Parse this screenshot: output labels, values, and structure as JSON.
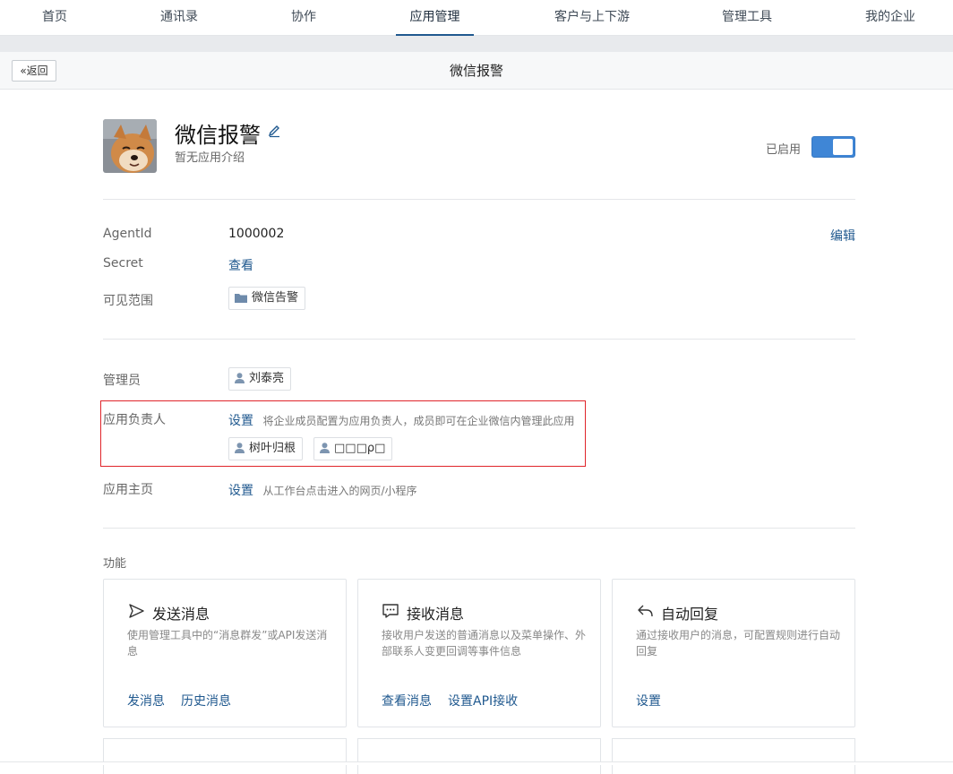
{
  "nav": {
    "items": [
      {
        "label": "首页"
      },
      {
        "label": "通讯录"
      },
      {
        "label": "协作"
      },
      {
        "label": "应用管理"
      },
      {
        "label": "客户与上下游"
      },
      {
        "label": "管理工具"
      },
      {
        "label": "我的企业"
      }
    ],
    "active_index": 3
  },
  "subheader": {
    "back_label": "返回",
    "title": "微信报警"
  },
  "app": {
    "name": "微信报警",
    "description": "暂无应用介绍",
    "status_label": "已启用",
    "enabled": true
  },
  "info": {
    "agentid_label": "AgentId",
    "agentid_value": "1000002",
    "edit_label": "编辑",
    "secret_label": "Secret",
    "secret_link": "查看",
    "scope_label": "可见范围",
    "scope_tag": "微信告警"
  },
  "admin": {
    "label": "管理员",
    "tag": "刘泰亮"
  },
  "owner": {
    "label": "应用负责人",
    "set_link": "设置",
    "hint": "将企业成员配置为应用负责人，成员即可在企业微信内管理此应用",
    "tags": [
      "树叶归根",
      "□□□ρ□"
    ]
  },
  "homepage": {
    "label": "应用主页",
    "set_link": "设置",
    "hint": "从工作台点击进入的网页/小程序"
  },
  "features": {
    "title": "功能",
    "cards": [
      {
        "icon": "send-icon",
        "title": "发送消息",
        "desc": "使用管理工具中的“消息群发”或API发送消息",
        "links": [
          "发消息",
          "历史消息"
        ]
      },
      {
        "icon": "chat-icon",
        "title": "接收消息",
        "desc": "接收用户发送的普通消息以及菜单操作、外部联系人变更回调等事件信息",
        "links": [
          "查看消息",
          "设置API接收"
        ]
      },
      {
        "icon": "reply-icon",
        "title": "自动回复",
        "desc": "通过接收用户的消息，可配置规则进行自动回复",
        "links": [
          "设置"
        ]
      }
    ]
  },
  "colors": {
    "accent": "#20598f",
    "toggle": "#3f86d6",
    "highlight": "#e0242a"
  }
}
